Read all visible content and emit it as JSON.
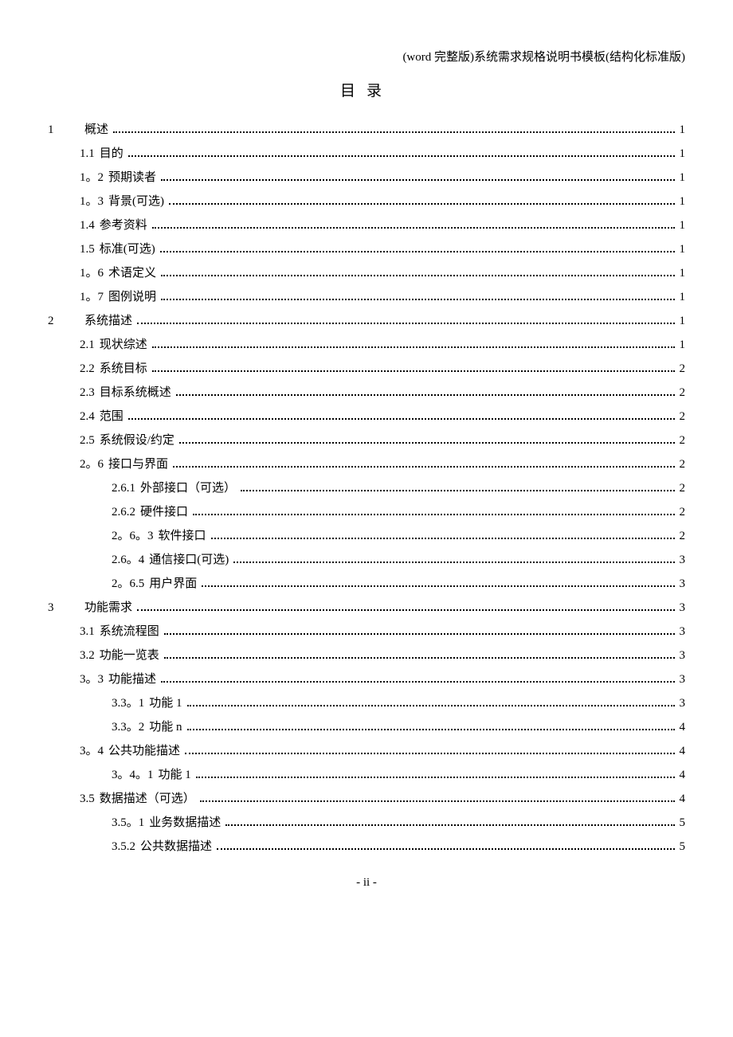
{
  "header": "(word 完整版)系统需求规格说明书模板(结构化标准版)",
  "title": "目录",
  "footer": "- ii -",
  "toc": [
    {
      "level": 1,
      "num": "1",
      "txt": "概述",
      "pg": "1"
    },
    {
      "level": 2,
      "num": "1.1",
      "txt": "目的",
      "pg": "1"
    },
    {
      "level": 2,
      "num": "1。2",
      "txt": "预期读者",
      "pg": "1"
    },
    {
      "level": 2,
      "num": "1。3",
      "txt": "背景(可选)",
      "pg": "1"
    },
    {
      "level": 2,
      "num": "1.4",
      "txt": "参考资料",
      "pg": "1"
    },
    {
      "level": 2,
      "num": "1.5",
      "txt": "标准(可选)",
      "pg": "1"
    },
    {
      "level": 2,
      "num": "1。6",
      "txt": "术语定义",
      "pg": "1"
    },
    {
      "level": 2,
      "num": "1。7",
      "txt": "图例说明",
      "pg": "1"
    },
    {
      "level": 1,
      "num": "2",
      "txt": "系统描述",
      "pg": "1"
    },
    {
      "level": 2,
      "num": "2.1",
      "txt": "现状综述",
      "pg": "1"
    },
    {
      "level": 2,
      "num": "2.2",
      "txt": "系统目标",
      "pg": "2"
    },
    {
      "level": 2,
      "num": "2.3",
      "txt": "目标系统概述",
      "pg": "2"
    },
    {
      "level": 2,
      "num": "2.4",
      "txt": "范围",
      "pg": "2"
    },
    {
      "level": 2,
      "num": "2.5",
      "txt": "系统假设/约定",
      "pg": "2"
    },
    {
      "level": 2,
      "num": "2。6",
      "txt": "接口与界面",
      "pg": "2"
    },
    {
      "level": 3,
      "num": "2.6.1",
      "txt": "外部接口（可选）",
      "pg": "2"
    },
    {
      "level": 3,
      "num": "2.6.2",
      "txt": "硬件接口",
      "pg": "2"
    },
    {
      "level": 3,
      "num": "2。6。3",
      "txt": "软件接口",
      "pg": "2"
    },
    {
      "level": 3,
      "num": "2.6。4",
      "txt": "通信接口(可选)",
      "pg": "3"
    },
    {
      "level": 3,
      "num": "2。6.5",
      "txt": "用户界面",
      "pg": "3"
    },
    {
      "level": 1,
      "num": "3",
      "txt": "功能需求",
      "pg": "3"
    },
    {
      "level": 2,
      "num": "3.1",
      "txt": "系统流程图",
      "pg": "3"
    },
    {
      "level": 2,
      "num": "3.2",
      "txt": "功能一览表",
      "pg": "3"
    },
    {
      "level": 2,
      "num": "3。3",
      "txt": "功能描述",
      "pg": "3"
    },
    {
      "level": 3,
      "num": "3.3。1",
      "txt": "功能 1",
      "pg": "3"
    },
    {
      "level": 3,
      "num": "3.3。2",
      "txt": "功能 n",
      "pg": "4"
    },
    {
      "level": 2,
      "num": "3。4",
      "txt": "公共功能描述",
      "pg": "4"
    },
    {
      "level": 3,
      "num": "3。4。1",
      "txt": "功能 1",
      "pg": "4"
    },
    {
      "level": 2,
      "num": "3.5",
      "txt": "数据描述（可选）",
      "pg": "4"
    },
    {
      "level": 3,
      "num": "3.5。1",
      "txt": "业务数据描述",
      "pg": "5"
    },
    {
      "level": 3,
      "num": "3.5.2",
      "txt": "公共数据描述",
      "pg": "5"
    }
  ]
}
